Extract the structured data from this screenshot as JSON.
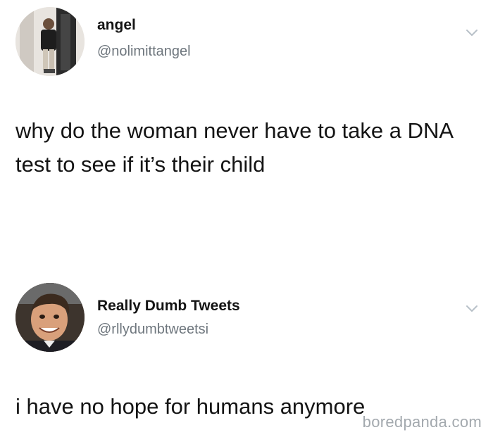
{
  "tweets": [
    {
      "name": "angel",
      "handle": "@nolimittangel",
      "text": "why do the woman never have to take a DNA test to see if it’s their child",
      "avatar": "user-photo-mirror-selfie",
      "menu_icon": "chevron-down-icon"
    },
    {
      "name": "Really Dumb Tweets",
      "handle": "@rllydumbtweetsi",
      "text": "i have no hope for humans anymore",
      "avatar": "user-photo-smiling-man",
      "menu_icon": "chevron-down-icon"
    }
  ],
  "watermark": "boredpanda.com",
  "colors": {
    "name": "#141414",
    "handle": "#6e767d",
    "chevron": "#b8c0c8",
    "watermark": "#9aa0a6"
  }
}
